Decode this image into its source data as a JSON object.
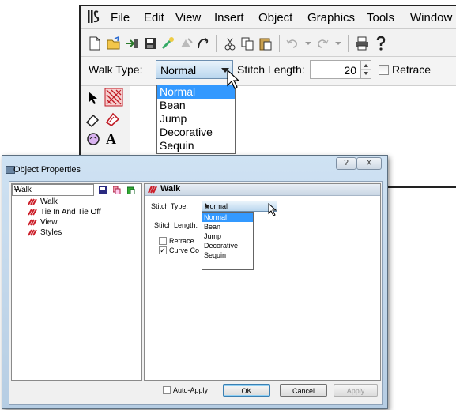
{
  "app": {
    "menu": [
      "File",
      "Edit",
      "View",
      "Insert",
      "Object",
      "Graphics",
      "Tools",
      "Window"
    ],
    "propbar": {
      "walk_type_label": "Walk Type:",
      "walk_type_value": "Normal",
      "stitch_length_label": "Stitch Length:",
      "stitch_length_value": "20",
      "retrace_label": "Retrace"
    },
    "walk_type_options": [
      "Normal",
      "Bean",
      "Jump",
      "Decorative",
      "Sequin"
    ],
    "walk_type_selected_index": 0
  },
  "dialog": {
    "title": "Object Properties",
    "help_glyph": "?",
    "close_glyph": "X",
    "tree_combo_value": "Walk",
    "tree_items": [
      "Walk",
      "Tie In And Tie Off",
      "View",
      "Styles"
    ],
    "header": "Walk",
    "stitch_type_label": "Stitch Type:",
    "stitch_type_value": "Normal",
    "stitch_length_label": "Stitch Length:",
    "stitch_type_options": [
      "Normal",
      "Bean",
      "Jump",
      "Decorative",
      "Sequin"
    ],
    "stitch_type_selected_index": 0,
    "retrace_label": "Retrace",
    "curve_label": "Curve Co",
    "auto_apply_label": "Auto-Apply",
    "ok_label": "OK",
    "cancel_label": "Cancel",
    "apply_label": "Apply"
  },
  "colors": {
    "selection": "#3399ff",
    "combo_blue": "#b9d6ee",
    "icon_red": "#cc1f2a"
  }
}
